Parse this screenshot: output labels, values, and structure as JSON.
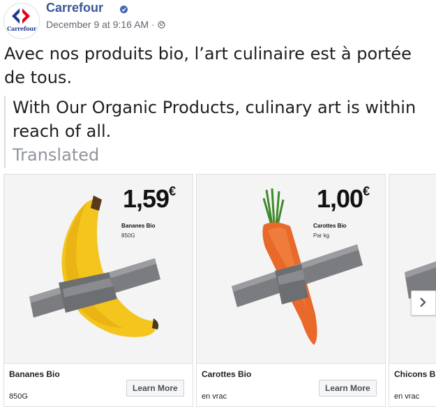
{
  "header": {
    "page_name": "Carrefour",
    "timestamp": "December 9 at 9:16 AM",
    "separator": "·",
    "avatar_text": "Carrefour",
    "brand_colors": {
      "blue": "#1f3a93",
      "red": "#e2001a"
    }
  },
  "post": {
    "text": "Avec nos produits bio, l’art culinaire est à portée de tous."
  },
  "translation": {
    "text": "With Our Organic Products, culinary art is within reach of all.",
    "label": "Translated"
  },
  "carousel": {
    "cards": [
      {
        "price_main": "1,59",
        "price_currency": "€",
        "image_product": "Bananes Bio",
        "image_sub": "850G",
        "title": "Bananes Bio",
        "description": "850G",
        "cta": "Learn More"
      },
      {
        "price_main": "1,00",
        "price_currency": "€",
        "image_product": "Carottes Bio",
        "image_sub": "Par kg",
        "title": "Carottes Bio",
        "description": "en vrac",
        "cta": "Learn More"
      },
      {
        "title": "Chicons B",
        "description": "en vrac"
      }
    ],
    "next_icon": "chevron-right-icon"
  }
}
